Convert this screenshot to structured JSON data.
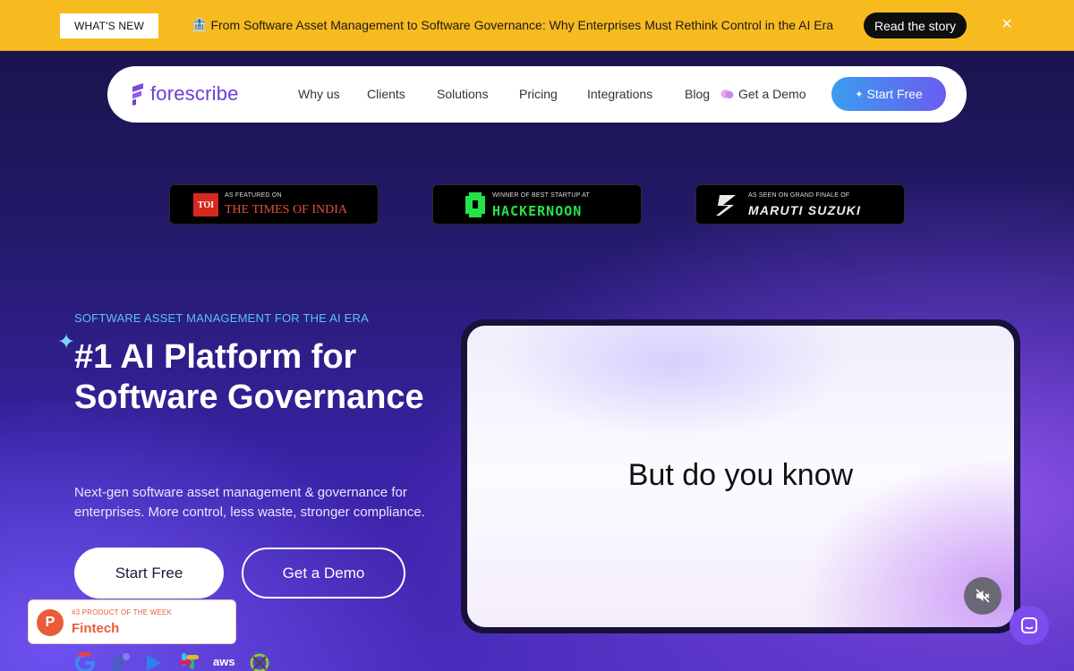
{
  "announcement": {
    "badge": "WHAT'S NEW",
    "headline": "From Software Asset Management to Software Governance: Why Enterprises Must Rethink Control in the AI Era",
    "cta": "Read the story"
  },
  "nav": {
    "brand": "forescribe",
    "items": [
      "Why us",
      "Clients",
      "Solutions",
      "Pricing",
      "Integrations",
      "Blog"
    ],
    "demo": "Get a Demo",
    "cta": "Start Free"
  },
  "press": [
    {
      "small": "AS FEATURED ON",
      "big": "THE TIMES OF INDIA",
      "mark": "TOI"
    },
    {
      "small": "WINNER OF BEST STARTUP AT",
      "big": "HACKERNOON"
    },
    {
      "small": "AS SEEN ON GRAND FINALE OF",
      "big": "MARUTI SUZUKI"
    }
  ],
  "hero": {
    "eyebrow": "SOFTWARE ASSET MANAGEMENT FOR THE AI ERA",
    "title": "#1 AI Platform for Software Governance",
    "subtitle": "Next-gen software asset management & governance for enterprises. More control, less waste, stronger compliance.",
    "primary_cta": "Start Free",
    "secondary_cta": "Get a Demo"
  },
  "video": {
    "caption": "But do you know"
  },
  "product_hunt": {
    "letter": "P",
    "rank": "#3 PRODUCT OF THE WEEK",
    "category": "Fintech"
  },
  "colors": {
    "announce_bg": "#f7bb20",
    "brand_purple": "#6b3fd4",
    "cta_gradient_start": "#3a9df0",
    "cta_gradient_end": "#6a5cf0",
    "eyebrow": "#59c4f6",
    "product_hunt": "#ea5b3a"
  }
}
